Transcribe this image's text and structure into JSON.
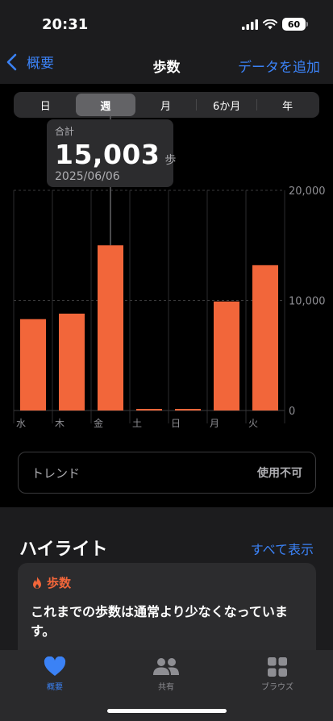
{
  "status": {
    "time": "20:31",
    "battery": "60"
  },
  "nav": {
    "back_label": "概要",
    "title": "歩数",
    "add_label": "データを追加"
  },
  "segments": [
    {
      "label": "日",
      "active": false
    },
    {
      "label": "週",
      "active": true
    },
    {
      "label": "月",
      "active": false
    },
    {
      "label": "6か月",
      "active": false
    },
    {
      "label": "年",
      "active": false
    }
  ],
  "callout": {
    "label": "合計",
    "value": "15,003",
    "unit": "歩",
    "date": "2025/06/06"
  },
  "chart_data": {
    "type": "bar",
    "categories": [
      "水",
      "木",
      "金",
      "土",
      "日",
      "月",
      "火"
    ],
    "values": [
      8300,
      8800,
      15003,
      120,
      120,
      9900,
      13200
    ],
    "selected_index": 2,
    "ylim": [
      0,
      20000
    ],
    "yticks": [
      0,
      10000,
      20000
    ],
    "ytick_labels": [
      "0",
      "10,000",
      "20,000"
    ],
    "grid": true,
    "bar_color": "#f2663a"
  },
  "trend": {
    "label": "トレンド",
    "value": "使用不可"
  },
  "highlights": {
    "title": "ハイライト",
    "show_all": "すべて表示",
    "card": {
      "category": "歩数",
      "text": "これまでの歩数は通常より少なくなっています。"
    }
  },
  "tabs": [
    {
      "label": "概要",
      "icon": "heart-icon",
      "active": true
    },
    {
      "label": "共有",
      "icon": "people-icon",
      "active": false
    },
    {
      "label": "ブラウズ",
      "icon": "grid-icon",
      "active": false
    }
  ],
  "colors": {
    "accent": "#3b82f6",
    "orange": "#f2663a"
  }
}
